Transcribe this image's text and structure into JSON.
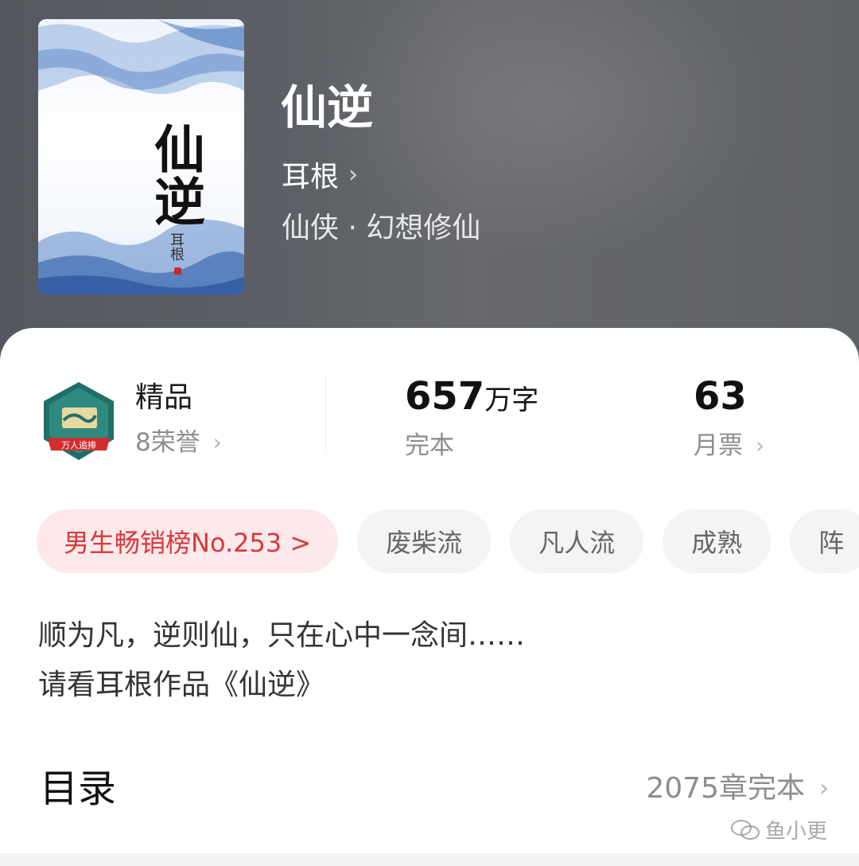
{
  "book": {
    "title": "仙逆",
    "author": "耳根",
    "author_chevron": "›",
    "genre": "仙侠 · 幻想修仙",
    "cover": {
      "title": "仙逆",
      "author": "耳根"
    }
  },
  "stats": {
    "honor": {
      "title": "精品",
      "sub": "8荣誉",
      "chevron": "›",
      "badge_text": "万人追捧"
    },
    "words": {
      "number": "657",
      "unit": "万字",
      "sub": "完本"
    },
    "tickets": {
      "number": "63",
      "sub": "月票",
      "chevron": "›"
    }
  },
  "tags": [
    "男生畅销榜No.253 >",
    "废柴流",
    "凡人流",
    "成熟",
    "阵"
  ],
  "intro": {
    "line1": "顺为凡，逆则仙，只在心中一念间……",
    "line2": "请看耳根作品《仙逆》"
  },
  "toc": {
    "title": "目录",
    "status": "2075章完本",
    "chevron": "›"
  },
  "watermark": "鱼小更",
  "colors": {
    "accent": "#d9373f",
    "accent_bg": "#fde9ea",
    "header_bg": "#5d6066"
  }
}
